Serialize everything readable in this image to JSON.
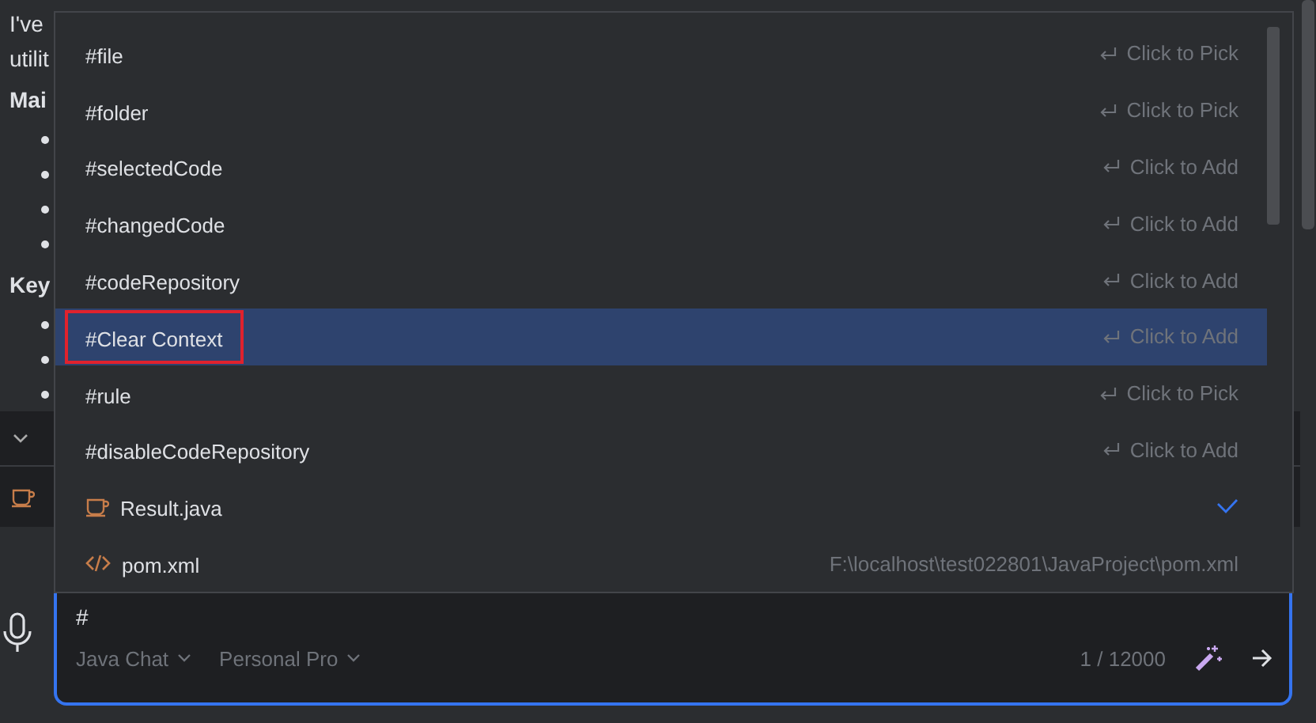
{
  "background": {
    "lines": [
      {
        "kind": "text",
        "text": "I've"
      },
      {
        "kind": "text",
        "text": "utilit"
      },
      {
        "kind": "heading",
        "text": "Mai"
      },
      {
        "kind": "bullet"
      },
      {
        "kind": "bullet"
      },
      {
        "kind": "bullet"
      },
      {
        "kind": "bullet"
      },
      {
        "kind": "heading",
        "text": "Key"
      },
      {
        "kind": "bullet"
      },
      {
        "kind": "bullet"
      },
      {
        "kind": "bullet"
      }
    ],
    "section": {
      "expanded": true
    }
  },
  "popup": {
    "items": [
      {
        "kind": "command",
        "label": "#file",
        "hint": "Click to Pick",
        "selected": false,
        "highlighted": false
      },
      {
        "kind": "command",
        "label": "#folder",
        "hint": "Click to Pick",
        "selected": false,
        "highlighted": false
      },
      {
        "kind": "command",
        "label": "#selectedCode",
        "hint": "Click to Add",
        "selected": false,
        "highlighted": false
      },
      {
        "kind": "command",
        "label": "#changedCode",
        "hint": "Click to Add",
        "selected": false,
        "highlighted": false
      },
      {
        "kind": "command",
        "label": "#codeRepository",
        "hint": "Click to Add",
        "selected": false,
        "highlighted": false
      },
      {
        "kind": "command",
        "label": "#Clear Context",
        "hint": "Click to Add",
        "selected": true,
        "highlighted": true
      },
      {
        "kind": "command",
        "label": "#rule",
        "hint": "Click to Pick",
        "selected": false,
        "highlighted": false
      },
      {
        "kind": "command",
        "label": "#disableCodeRepository",
        "hint": "Click to Add",
        "selected": false,
        "highlighted": false
      },
      {
        "kind": "java",
        "label": "Result.java",
        "checked": true,
        "selected": false,
        "highlighted": false
      },
      {
        "kind": "xml",
        "label": "pom.xml",
        "hint": "F:\\localhost\\test022801\\JavaProject\\pom.xml",
        "selected": false,
        "highlighted": false
      }
    ]
  },
  "input": {
    "value": "#",
    "mode": "Java Chat",
    "plan": "Personal Pro",
    "counter": "1 / 12000"
  }
}
